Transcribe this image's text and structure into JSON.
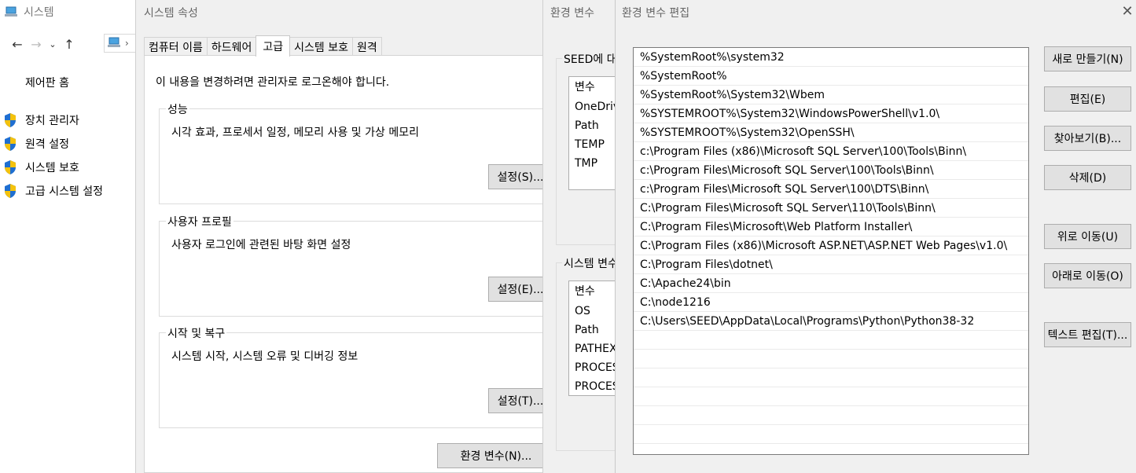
{
  "control_panel": {
    "title": "시스템",
    "home": "제어판 홈",
    "links": [
      "장치 관리자",
      "원격 설정",
      "시스템 보호",
      "고급 시스템 설정"
    ]
  },
  "system_properties": {
    "title": "시스템 속성",
    "tabs": [
      "컴퓨터 이름",
      "하드웨어",
      "고급",
      "시스템 보호",
      "원격"
    ],
    "active_tab": 2,
    "notice": "이 내용을 변경하려면 관리자로 로그온해야 합니다.",
    "groups": [
      {
        "label": "성능",
        "desc": "시각 효과, 프로세서 일정, 메모리 사용 및 가상 메모리",
        "button": "설정(S)..."
      },
      {
        "label": "사용자 프로필",
        "desc": "사용자 로그인에 관련된 바탕 화면 설정",
        "button": "설정(E)..."
      },
      {
        "label": "시작 및 복구",
        "desc": "시스템 시작, 시스템 오류 및 디버깅 정보",
        "button": "설정(T)..."
      }
    ],
    "env_button": "환경 변수(N)..."
  },
  "env_vars": {
    "title": "환경 변수",
    "user_group_label": "SEED에 대한 사용자 변수(U)",
    "user_header": "변수",
    "user_vars": [
      "OneDrive",
      "Path",
      "TEMP",
      "TMP"
    ],
    "system_group_label": "시스템 변수(S)",
    "system_header": "변수",
    "system_vars": [
      "OS",
      "Path",
      "PATHEXT",
      "PROCESSOR_ARCHITECTURE",
      "PROCESSOR_IDENTIFIER"
    ]
  },
  "edit_env": {
    "title": "환경 변수 편집",
    "paths": [
      "%SystemRoot%\\system32",
      "%SystemRoot%",
      "%SystemRoot%\\System32\\Wbem",
      "%SYSTEMROOT%\\System32\\WindowsPowerShell\\v1.0\\",
      "%SYSTEMROOT%\\System32\\OpenSSH\\",
      "c:\\Program Files (x86)\\Microsoft SQL Server\\100\\Tools\\Binn\\",
      "c:\\Program Files\\Microsoft SQL Server\\100\\Tools\\Binn\\",
      "c:\\Program Files\\Microsoft SQL Server\\100\\DTS\\Binn\\",
      "C:\\Program Files\\Microsoft SQL Server\\110\\Tools\\Binn\\",
      "C:\\Program Files\\Microsoft\\Web Platform Installer\\",
      "C:\\Program Files (x86)\\Microsoft ASP.NET\\ASP.NET Web Pages\\v1.0\\",
      "C:\\Program Files\\dotnet\\",
      "C:\\Apache24\\bin",
      "C:\\node1216",
      "C:\\Users\\SEED\\AppData\\Local\\Programs\\Python\\Python38-32"
    ],
    "buttons": {
      "new": "새로 만들기(N)",
      "edit": "편집(E)",
      "browse": "찾아보기(B)...",
      "delete": "삭제(D)",
      "move_up": "위로 이동(U)",
      "move_down": "아래로 이동(O)",
      "edit_text": "텍스트 편집(T)..."
    }
  }
}
